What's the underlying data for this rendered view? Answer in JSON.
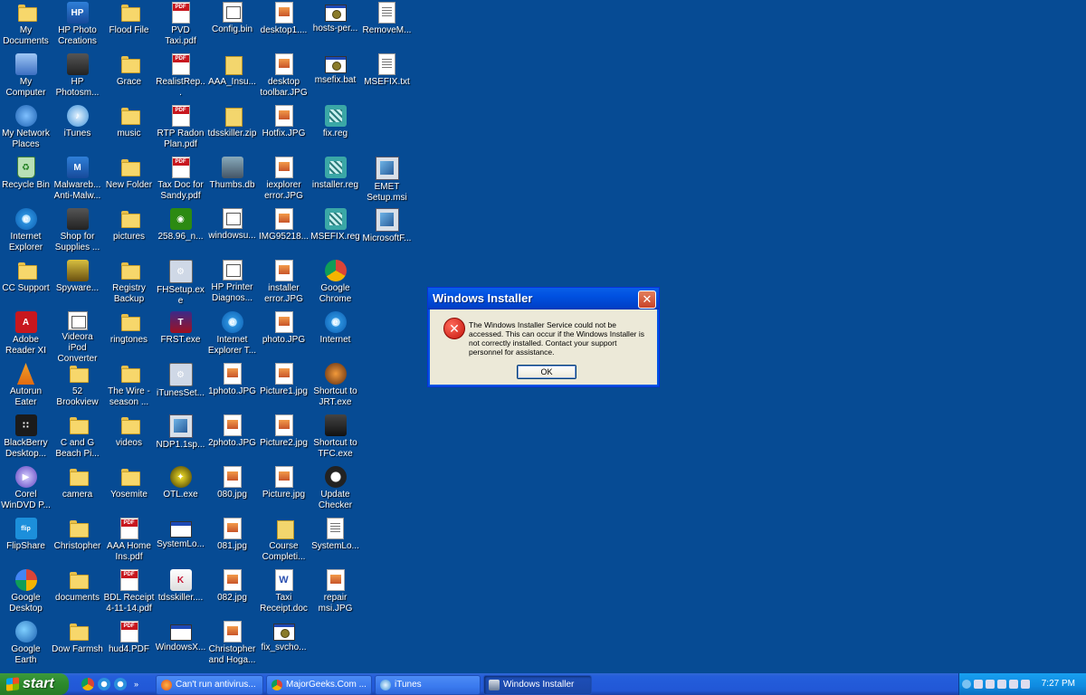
{
  "desktop": {
    "columns": [
      [
        {
          "label": "My Documents",
          "icon": "my-documents-icon",
          "kind": "folder"
        },
        {
          "label": "My Computer",
          "icon": "my-computer-icon",
          "kind": "computer"
        },
        {
          "label": "My Network Places",
          "icon": "network-places-icon",
          "kind": "network"
        },
        {
          "label": "Recycle Bin",
          "icon": "recycle-bin-icon",
          "kind": "recycle"
        },
        {
          "label": "Internet Explorer",
          "icon": "internet-explorer-icon",
          "kind": "ie"
        },
        {
          "label": "CC Support",
          "icon": "folder-icon",
          "kind": "folder"
        },
        {
          "label": "Adobe Reader XI",
          "icon": "adobe-reader-icon",
          "kind": "adobe"
        },
        {
          "label": "Autorun Eater",
          "icon": "autorun-eater-icon",
          "kind": "cone"
        },
        {
          "label": "BlackBerry Desktop...",
          "icon": "blackberry-icon",
          "kind": "bb"
        },
        {
          "label": "Corel WinDVD P...",
          "icon": "windvd-icon",
          "kind": "dvd"
        },
        {
          "label": "FlipShare",
          "icon": "flipshare-icon",
          "kind": "flip"
        },
        {
          "label": "Google Desktop",
          "icon": "google-desktop-icon",
          "kind": "gdesk"
        },
        {
          "label": "Google Earth",
          "icon": "google-earth-icon",
          "kind": "earth"
        }
      ],
      [
        {
          "label": "HP Photo Creations",
          "icon": "hp-photo-icon",
          "kind": "hp"
        },
        {
          "label": "HP Photosm...",
          "icon": "hp-photosmart-icon",
          "kind": "printer"
        },
        {
          "label": "iTunes",
          "icon": "itunes-icon",
          "kind": "itunes"
        },
        {
          "label": "Malwareb... Anti-Malw...",
          "icon": "malwarebytes-icon",
          "kind": "mbam"
        },
        {
          "label": "Shop for Supplies ...",
          "icon": "shop-supplies-icon",
          "kind": "printer"
        },
        {
          "label": "Spyware...",
          "icon": "spyware-icon",
          "kind": "spy"
        },
        {
          "label": "Videora iPod Converter",
          "icon": "videora-icon",
          "kind": "bin"
        },
        {
          "label": "52 Brookview",
          "icon": "folder-icon",
          "kind": "folder"
        },
        {
          "label": "C and G Beach Pi...",
          "icon": "folder-icon",
          "kind": "folder"
        },
        {
          "label": "camera",
          "icon": "folder-icon",
          "kind": "folder"
        },
        {
          "label": "Christopher",
          "icon": "folder-icon",
          "kind": "folder"
        },
        {
          "label": "documents",
          "icon": "folder-icon",
          "kind": "folder"
        },
        {
          "label": "Dow Farmsh",
          "icon": "folder-icon",
          "kind": "folder"
        }
      ],
      [
        {
          "label": "Flood File",
          "icon": "folder-icon",
          "kind": "folder"
        },
        {
          "label": "Grace",
          "icon": "folder-icon",
          "kind": "folder"
        },
        {
          "label": "music",
          "icon": "folder-icon",
          "kind": "folder"
        },
        {
          "label": "New Folder",
          "icon": "folder-icon",
          "kind": "folder"
        },
        {
          "label": "pictures",
          "icon": "folder-icon",
          "kind": "folder"
        },
        {
          "label": "Registry Backup",
          "icon": "folder-icon",
          "kind": "folder"
        },
        {
          "label": "ringtones",
          "icon": "folder-icon",
          "kind": "folder"
        },
        {
          "label": "The Wire - season ...",
          "icon": "folder-icon",
          "kind": "folder"
        },
        {
          "label": "videos",
          "icon": "folder-icon",
          "kind": "folder"
        },
        {
          "label": "Yosemite",
          "icon": "folder-icon",
          "kind": "folder"
        },
        {
          "label": "AAA Home Ins.pdf",
          "icon": "pdf-icon",
          "kind": "pdf"
        },
        {
          "label": "BDL Receipt 4-11-14.pdf",
          "icon": "pdf-icon",
          "kind": "pdf"
        },
        {
          "label": "hud4.PDF",
          "icon": "pdf-icon",
          "kind": "pdf"
        }
      ],
      [
        {
          "label": "PVD Taxi.pdf",
          "icon": "pdf-icon",
          "kind": "pdf"
        },
        {
          "label": "RealistRep...",
          "icon": "pdf-icon",
          "kind": "pdf"
        },
        {
          "label": "RTP Radon Plan.pdf",
          "icon": "pdf-icon",
          "kind": "pdf"
        },
        {
          "label": "Tax Doc for Sandy.pdf",
          "icon": "pdf-icon",
          "kind": "pdf"
        },
        {
          "label": "258.96_n...",
          "icon": "nvidia-icon",
          "kind": "nvidia"
        },
        {
          "label": "FHSetup.exe",
          "icon": "setup-icon",
          "kind": "exe"
        },
        {
          "label": "FRST.exe",
          "icon": "frst-icon",
          "kind": "frst"
        },
        {
          "label": "iTunesSet...",
          "icon": "itunes-setup-icon",
          "kind": "exe"
        },
        {
          "label": "NDP1.1sp...",
          "icon": "msi-icon",
          "kind": "msi"
        },
        {
          "label": "OTL.exe",
          "icon": "otl-icon",
          "kind": "otl"
        },
        {
          "label": "SystemLo...",
          "icon": "window-icon",
          "kind": "win"
        },
        {
          "label": "tdsskiller....",
          "icon": "kaspersky-icon",
          "kind": "kas"
        },
        {
          "label": "WindowsX...",
          "icon": "window-icon",
          "kind": "win"
        }
      ],
      [
        {
          "label": "Config.bin",
          "icon": "bin-file-icon",
          "kind": "bin"
        },
        {
          "label": "AAA_Insu...",
          "icon": "zip-icon",
          "kind": "zip"
        },
        {
          "label": "tdsskiller.zip",
          "icon": "zip-icon",
          "kind": "zip"
        },
        {
          "label": "Thumbs.db",
          "icon": "db-file-icon",
          "kind": "db"
        },
        {
          "label": "windowsu...",
          "icon": "bin-file-icon",
          "kind": "bin"
        },
        {
          "label": "HP Printer Diagnos...",
          "icon": "bin-file-icon",
          "kind": "bin"
        },
        {
          "label": "Internet Explorer T...",
          "icon": "internet-explorer-icon",
          "kind": "ie"
        },
        {
          "label": "1photo.JPG",
          "icon": "image-file-icon",
          "kind": "img"
        },
        {
          "label": "2photo.JPG",
          "icon": "image-file-icon",
          "kind": "img"
        },
        {
          "label": "080.jpg",
          "icon": "image-file-icon",
          "kind": "img"
        },
        {
          "label": "081.jpg",
          "icon": "image-file-icon",
          "kind": "img"
        },
        {
          "label": "082.jpg",
          "icon": "image-file-icon",
          "kind": "img"
        },
        {
          "label": "Christopher and Hoga...",
          "icon": "image-file-icon",
          "kind": "img"
        }
      ],
      [
        {
          "label": "desktop1....",
          "icon": "image-file-icon",
          "kind": "img"
        },
        {
          "label": "desktop toolbar.JPG",
          "icon": "image-file-icon",
          "kind": "img"
        },
        {
          "label": "Hotfix.JPG",
          "icon": "image-file-icon",
          "kind": "img"
        },
        {
          "label": "iexplorer error.JPG",
          "icon": "image-file-icon",
          "kind": "img"
        },
        {
          "label": "IMG95218...",
          "icon": "image-file-icon",
          "kind": "img"
        },
        {
          "label": "installer error.JPG",
          "icon": "image-file-icon",
          "kind": "img"
        },
        {
          "label": "photo.JPG",
          "icon": "image-file-icon",
          "kind": "img"
        },
        {
          "label": "Picture1.jpg",
          "icon": "image-file-icon",
          "kind": "img"
        },
        {
          "label": "Picture2.jpg",
          "icon": "image-file-icon",
          "kind": "img"
        },
        {
          "label": "Picture.jpg",
          "icon": "image-file-icon",
          "kind": "img"
        },
        {
          "label": "Course Completi...",
          "icon": "certificate-icon",
          "kind": "zip"
        },
        {
          "label": "Taxi Receipt.doc",
          "icon": "word-doc-icon",
          "kind": "doc"
        },
        {
          "label": "fix_svcho...",
          "icon": "batch-file-icon",
          "kind": "gear"
        }
      ],
      [
        {
          "label": "hosts-per...",
          "icon": "batch-file-icon",
          "kind": "gear"
        },
        {
          "label": "msefix.bat",
          "icon": "batch-file-icon",
          "kind": "gear"
        },
        {
          "label": "fix.reg",
          "icon": "registry-file-icon",
          "kind": "reg"
        },
        {
          "label": "installer.reg",
          "icon": "registry-file-icon",
          "kind": "reg"
        },
        {
          "label": "MSEFIX.reg",
          "icon": "registry-file-icon",
          "kind": "reg"
        },
        {
          "label": "Google Chrome",
          "icon": "chrome-icon",
          "kind": "chrome"
        },
        {
          "label": "Internet",
          "icon": "internet-explorer-icon",
          "kind": "ie"
        },
        {
          "label": "Shortcut to JRT.exe",
          "icon": "jrt-icon",
          "kind": "jrt"
        },
        {
          "label": "Shortcut to TFC.exe",
          "icon": "tfc-icon",
          "kind": "tfc"
        },
        {
          "label": "Update Checker",
          "icon": "update-checker-icon",
          "kind": "upd"
        },
        {
          "label": "SystemLo...",
          "icon": "text-file-icon",
          "kind": "txt"
        },
        {
          "label": "repair msi.JPG",
          "icon": "image-file-icon",
          "kind": "img"
        }
      ],
      [
        {
          "label": "RemoveM...",
          "icon": "text-file-icon",
          "kind": "txt"
        },
        {
          "label": "MSEFIX.txt",
          "icon": "text-file-icon",
          "kind": "txt"
        },
        {
          "label": "",
          "icon": "",
          "kind": "none"
        },
        {
          "label": "EMET Setup.msi",
          "icon": "msi-icon",
          "kind": "msi"
        },
        {
          "label": "MicrosoftF...",
          "icon": "msi-icon",
          "kind": "msi"
        }
      ]
    ]
  },
  "dialog": {
    "title": "Windows Installer",
    "close_glyph": "✕",
    "error_glyph": "✕",
    "message": "The Windows Installer Service could not be accessed. This can occur if the Windows Installer is not correctly installed. Contact your support personnel for assistance.",
    "ok_label": "OK"
  },
  "taskbar": {
    "start_label": "start",
    "quick_more": "»",
    "tasks": [
      {
        "label": "Can't run antivirus...",
        "icon": "firefox-icon",
        "active": false
      },
      {
        "label": "MajorGeeks.Com ...",
        "icon": "chrome-icon",
        "active": false
      },
      {
        "label": "iTunes",
        "icon": "itunes-icon",
        "active": false
      },
      {
        "label": "Windows Installer",
        "icon": "installer-icon",
        "active": true
      }
    ],
    "clock": "7:27 PM"
  }
}
